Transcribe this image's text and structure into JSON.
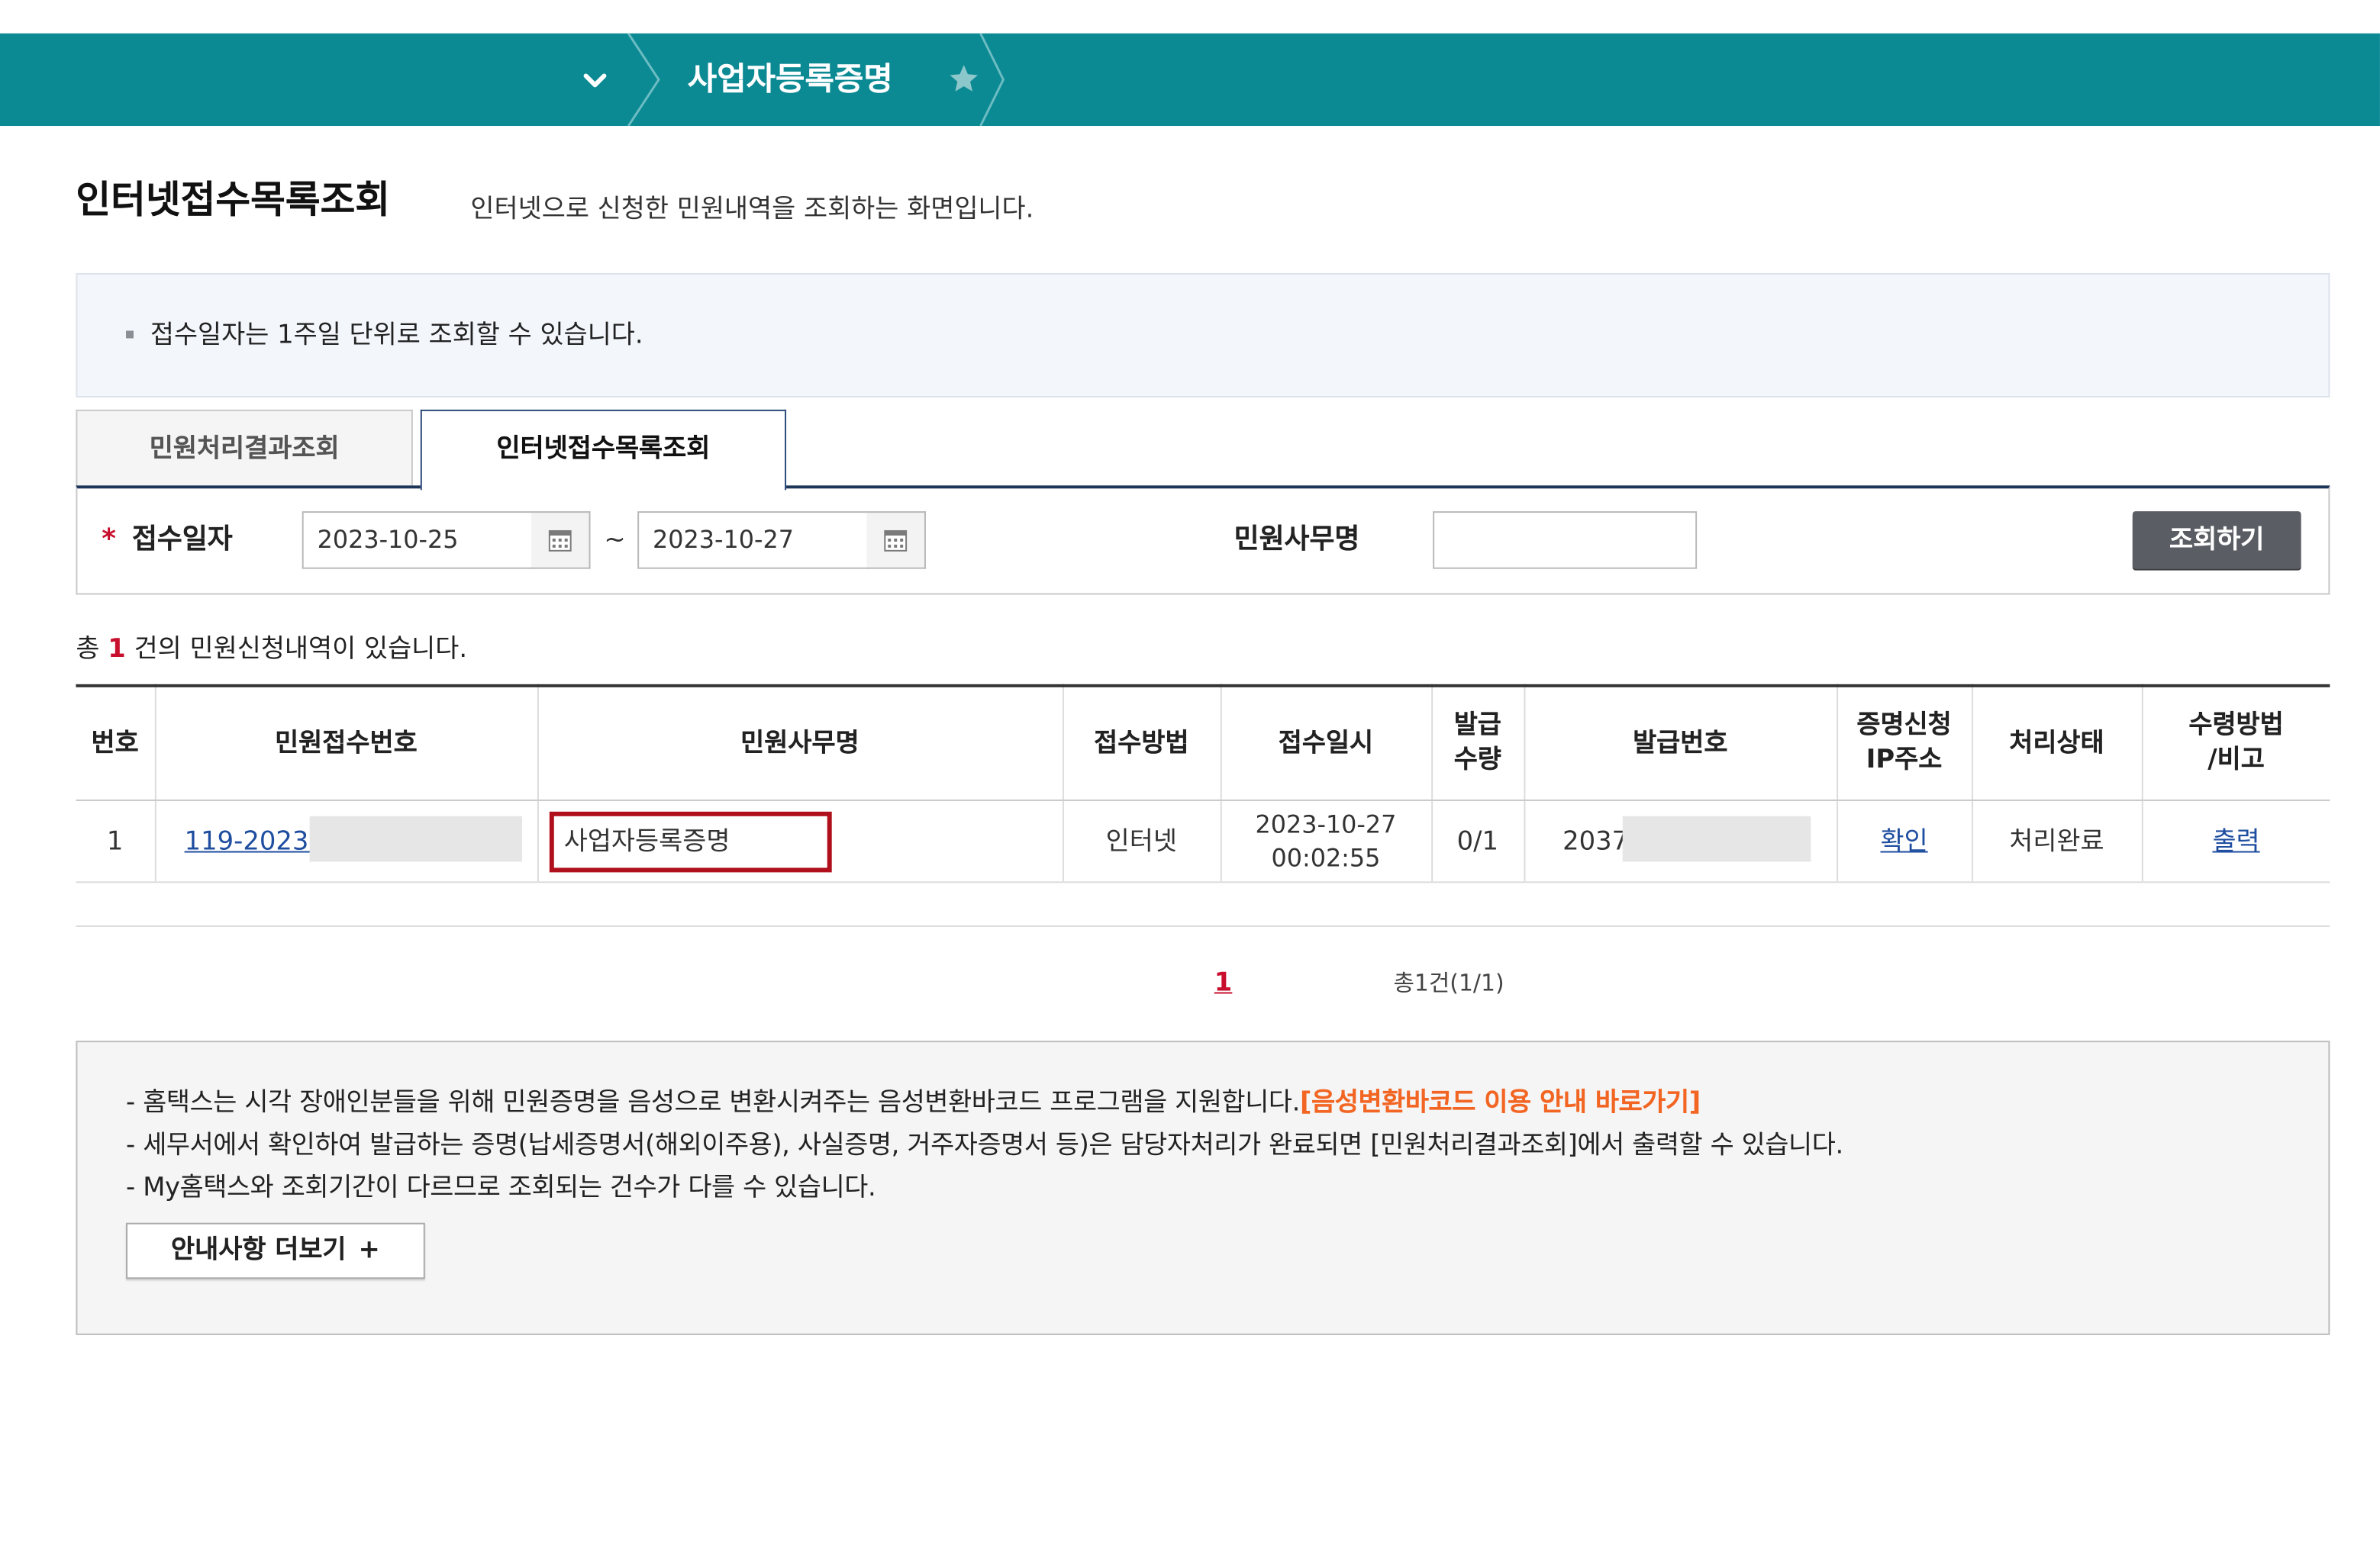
{
  "colors": {
    "topbar": "#0b8a94",
    "accent_red": "#c8102e",
    "link_blue": "#1f4ea0",
    "link_orange": "#f26522",
    "search_button": "#5a5d63",
    "highlight_border": "#b0101c"
  },
  "icons": {
    "menu_toggle": "chevron-down-icon",
    "favorite": "star-icon",
    "date_picker": "calendar-icon"
  },
  "topbar": {
    "breadcrumb_current": "사업자등록증명"
  },
  "page": {
    "title": "인터넷접수목록조회",
    "subtitle": "인터넷으로 신청한 민원내역을 조회하는 화면입니다."
  },
  "info": {
    "text": "접수일자는 1주일 단위로 조회할 수 있습니다."
  },
  "tabs": [
    {
      "label": "민원처리결과조회"
    },
    {
      "label": "인터넷접수목록조회"
    }
  ],
  "active_tab_index": 1,
  "search": {
    "required_mark": "*",
    "date_label": "접수일자",
    "date_from": "2023-10-25",
    "separator": "~",
    "date_to": "2023-10-27",
    "service_label": "민원사무명",
    "service_value": "",
    "submit_label": "조회하기"
  },
  "summary": {
    "prefix": "총",
    "count": "1",
    "suffix": "건의 민원신청내역이 있습니다."
  },
  "table": {
    "headers": [
      "번호",
      "민원접수번호",
      "민원사무명",
      "접수방법",
      "접수일시",
      "발급\n수량",
      "발급번호",
      "증명신청\nIP주소",
      "처리상태",
      "수령방법\n/비고"
    ],
    "rows": [
      {
        "no": "1",
        "receipt_no": "119-2023-",
        "service": "사업자등록증명",
        "method": "인터넷",
        "date": "2023-10-27",
        "time": "00:02:55",
        "qty": "0/1",
        "issue_no": "2037",
        "ip": "확인",
        "status": "처리완료",
        "delivery": "출력"
      }
    ]
  },
  "pagination": {
    "current": "1",
    "total_text": "총1건(1/1)"
  },
  "notice": {
    "line1": "- 홈택스는 시각 장애인분들을 위해 민원증명을 음성으로 변환시켜주는 음성변환바코드 프로그램을 지원합니다.",
    "line1_link": "[음성변환바코드 이용 안내 바로가기]",
    "line2": "- 세무서에서 확인하여 발급하는 증명(납세증명서(해외이주용), 사실증명, 거주자증명서 등)은 담당자처리가 완료되면 [민원처리결과조회]에서 출력할 수 있습니다.",
    "line3": "- My홈택스와 조회기간이 다르므로 조회되는 건수가 다를 수 있습니다.",
    "more_label": "안내사항 더보기",
    "more_plus": "+"
  }
}
